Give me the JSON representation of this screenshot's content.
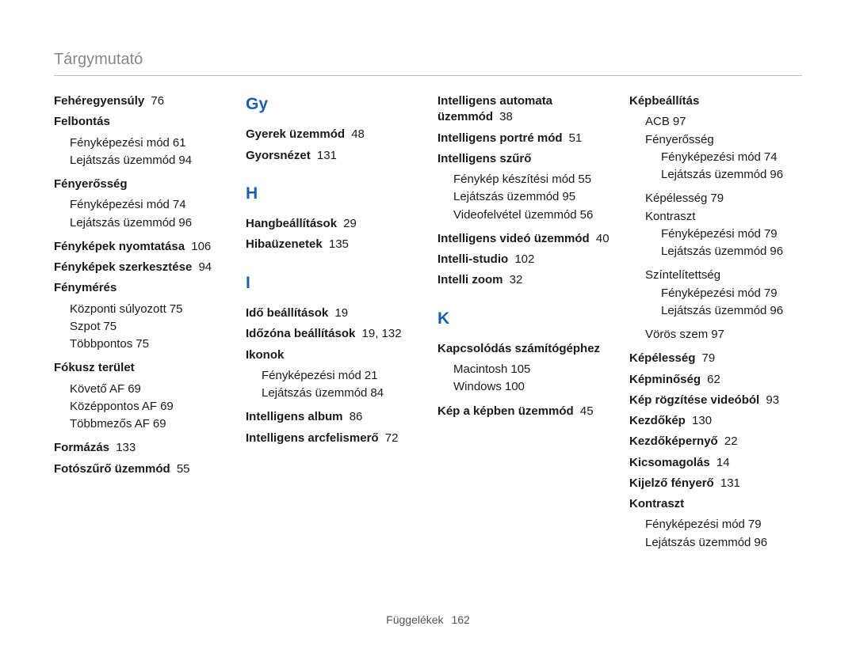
{
  "header": {
    "title": "Tárgymutató"
  },
  "footer": {
    "label": "Függelékek",
    "page": "162"
  },
  "columns": [
    {
      "blocks": [
        {
          "type": "entry",
          "bold": true,
          "label": "Fehéregyensúly",
          "page": "76"
        },
        {
          "type": "entry",
          "bold": true,
          "label": "Felbontás",
          "subs": [
            {
              "label": "Fényképezési mód",
              "page": "61"
            },
            {
              "label": "Lejátszás üzemmód",
              "page": "94"
            }
          ]
        },
        {
          "type": "entry",
          "bold": true,
          "label": "Fényerősség",
          "subs": [
            {
              "label": "Fényképezési mód",
              "page": "74"
            },
            {
              "label": "Lejátszás üzemmód",
              "page": "96"
            }
          ]
        },
        {
          "type": "entry",
          "bold": true,
          "label": "Fényképek nyomtatása",
          "page": "106"
        },
        {
          "type": "entry",
          "bold": true,
          "label": "Fényképek szerkesztése",
          "page": "94"
        },
        {
          "type": "entry",
          "bold": true,
          "label": "Fénymérés",
          "subs": [
            {
              "label": "Központi súlyozott",
              "page": "75"
            },
            {
              "label": "Szpot",
              "page": "75"
            },
            {
              "label": "Többpontos",
              "page": "75"
            }
          ]
        },
        {
          "type": "entry",
          "bold": true,
          "label": "Fókusz terület",
          "subs": [
            {
              "label": "Követő AF",
              "page": "69"
            },
            {
              "label": "Középpontos AF",
              "page": "69"
            },
            {
              "label": "Többmezős AF",
              "page": "69"
            }
          ]
        },
        {
          "type": "entry",
          "bold": true,
          "label": "Formázás",
          "page": "133"
        },
        {
          "type": "entry",
          "bold": true,
          "label": "Fotószűrő üzemmód",
          "page": "55"
        }
      ]
    },
    {
      "blocks": [
        {
          "type": "letter",
          "label": "Gy"
        },
        {
          "type": "entry",
          "bold": true,
          "label": "Gyerek üzemmód",
          "page": "48"
        },
        {
          "type": "entry",
          "bold": true,
          "label": "Gyorsnézet",
          "page": "131"
        },
        {
          "type": "gap"
        },
        {
          "type": "letter",
          "label": "H"
        },
        {
          "type": "entry",
          "bold": true,
          "label": "Hangbeállítások",
          "page": "29"
        },
        {
          "type": "entry",
          "bold": true,
          "label": "Hibaüzenetek",
          "page": "135"
        },
        {
          "type": "gap"
        },
        {
          "type": "letter",
          "label": "I"
        },
        {
          "type": "entry",
          "bold": true,
          "label": "Idő beállítások",
          "page": "19"
        },
        {
          "type": "entry",
          "bold": true,
          "label": "Időzóna beállítások",
          "page": "19, 132"
        },
        {
          "type": "entry",
          "bold": true,
          "label": "Ikonok",
          "subs": [
            {
              "label": "Fényképezési mód",
              "page": "21"
            },
            {
              "label": "Lejátszás üzemmód",
              "page": "84"
            }
          ]
        },
        {
          "type": "entry",
          "bold": true,
          "label": "Intelligens album",
          "page": "86"
        },
        {
          "type": "entry",
          "bold": true,
          "label": "Intelligens arcfelismerő",
          "page": "72"
        }
      ]
    },
    {
      "blocks": [
        {
          "type": "entry",
          "bold": true,
          "label": "Intelligens automata üzemmód",
          "page": "38"
        },
        {
          "type": "entry",
          "bold": true,
          "label": "Intelligens portré mód",
          "page": "51"
        },
        {
          "type": "entry",
          "bold": true,
          "label": "Intelligens szűrő",
          "subs": [
            {
              "label": "Fénykép készítési mód",
              "page": "55"
            },
            {
              "label": "Lejátszás üzemmód",
              "page": "95"
            },
            {
              "label": "Videofelvétel üzemmód",
              "page": "56"
            }
          ]
        },
        {
          "type": "entry",
          "bold": true,
          "label": "Intelligens videó üzemmód",
          "page": "40"
        },
        {
          "type": "entry",
          "bold": true,
          "label": "Intelli-studio",
          "page": "102"
        },
        {
          "type": "entry",
          "bold": true,
          "label": "Intelli zoom",
          "page": "32"
        },
        {
          "type": "gap"
        },
        {
          "type": "letter",
          "label": "K"
        },
        {
          "type": "entry",
          "bold": true,
          "label": "Kapcsolódás számítógéphez",
          "subs": [
            {
              "label": "Macintosh",
              "page": "105"
            },
            {
              "label": "Windows",
              "page": "100"
            }
          ]
        },
        {
          "type": "entry",
          "bold": true,
          "label": "Kép a képben üzemmód",
          "page": "45"
        }
      ]
    },
    {
      "blocks": [
        {
          "type": "entry",
          "bold": true,
          "label": "Képbeállítás",
          "subs": [
            {
              "label": "ACB",
              "page": "97"
            },
            {
              "label": "Fényerősség",
              "subs": [
                {
                  "label": "Fényképezési mód",
                  "page": "74"
                },
                {
                  "label": "Lejátszás üzemmód",
                  "page": "96"
                }
              ]
            },
            {
              "label": "Képélesség",
              "page": "79"
            },
            {
              "label": "Kontraszt",
              "subs": [
                {
                  "label": "Fényképezési mód",
                  "page": "79"
                },
                {
                  "label": "Lejátszás üzemmód",
                  "page": "96"
                }
              ]
            },
            {
              "label": "Színtelítettség",
              "subs": [
                {
                  "label": "Fényképezési mód",
                  "page": "79"
                },
                {
                  "label": "Lejátszás üzemmód",
                  "page": "96"
                }
              ]
            },
            {
              "label": "Vörös szem",
              "page": "97"
            }
          ]
        },
        {
          "type": "entry",
          "bold": true,
          "label": "Képélesség",
          "page": "79"
        },
        {
          "type": "entry",
          "bold": true,
          "label": "Képminőség",
          "page": "62"
        },
        {
          "type": "entry",
          "bold": true,
          "label": "Kép rögzítése videóból",
          "page": "93"
        },
        {
          "type": "entry",
          "bold": true,
          "label": "Kezdőkép",
          "page": "130"
        },
        {
          "type": "entry",
          "bold": true,
          "label": "Kezdőképernyő",
          "page": "22"
        },
        {
          "type": "entry",
          "bold": true,
          "label": "Kicsomagolás",
          "page": "14"
        },
        {
          "type": "entry",
          "bold": true,
          "label": "Kijelző fényerő",
          "page": "131"
        },
        {
          "type": "entry",
          "bold": true,
          "label": "Kontraszt",
          "subs": [
            {
              "label": "Fényképezési mód",
              "page": "79"
            },
            {
              "label": "Lejátszás üzemmód",
              "page": "96"
            }
          ]
        }
      ]
    }
  ]
}
